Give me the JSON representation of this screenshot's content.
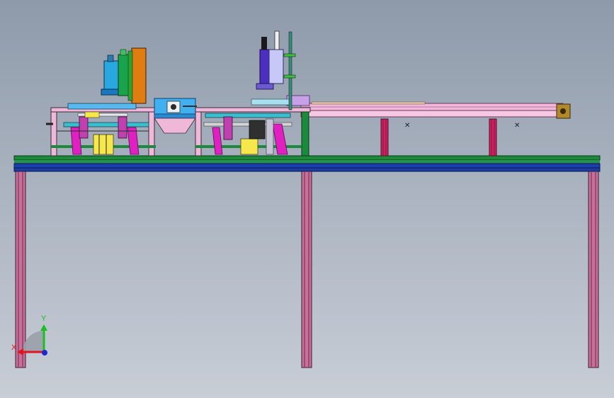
{
  "triad": {
    "x_label": "X",
    "y_label": "Y",
    "x_color": "#e0141e",
    "y_color": "#18c020",
    "z_color": "#1a2ad0"
  },
  "colors": {
    "background_top": "#8e9aaa",
    "background_bottom": "#c8cdd6",
    "table_leg": "#c0608e",
    "table_top_green": "#1c8a3c",
    "table_top_blue": "#1a40b0",
    "rail": "#f0b8dc",
    "motor_blue": "#29a8e0",
    "motor_green": "#19a34a",
    "motor_orange": "#e07d10",
    "motor_purple": "#4b2fc0",
    "magenta_part": "#e020c0",
    "yellow_part": "#f0e020",
    "end_block": "#b08a2a"
  },
  "icons": {
    "axis_triad": "coordinate-triad-icon"
  }
}
